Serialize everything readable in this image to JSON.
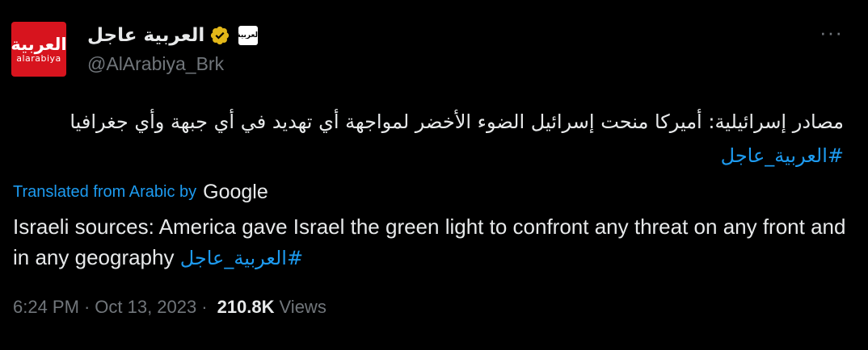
{
  "author": {
    "display_name": "العربية عاجل",
    "handle": "@AlArabiya_Brk",
    "avatar_text_ar": "العربية",
    "avatar_text_en": "alarabiya",
    "affiliate_badge_text": "العربية",
    "verified_icon": "verified-badge-icon",
    "brand_color": "#d7141e"
  },
  "tweet": {
    "text_ar": "مصادر إسرائيلية: أميركا منحت إسرائيل الضوء الأخضر لمواجهة أي تهديد في أي جبهة وأي جغرافيا",
    "hashtag": "#العربية_عاجل",
    "translated_label": "Translated from Arabic by",
    "translator": "Google",
    "translation": "Israeli sources: America gave Israel the green light to confront any threat on any front and in any geography"
  },
  "meta": {
    "time": "6:24 PM",
    "date": "Oct 13, 2023",
    "separator": "·",
    "views_count": "210.8K",
    "views_label": "Views"
  },
  "menu": {
    "more_label": "···"
  },
  "colors": {
    "background": "#000000",
    "text": "#e7e9ea",
    "secondary": "#71767b",
    "link": "#1d9bf0",
    "verified": "#e2b719"
  }
}
